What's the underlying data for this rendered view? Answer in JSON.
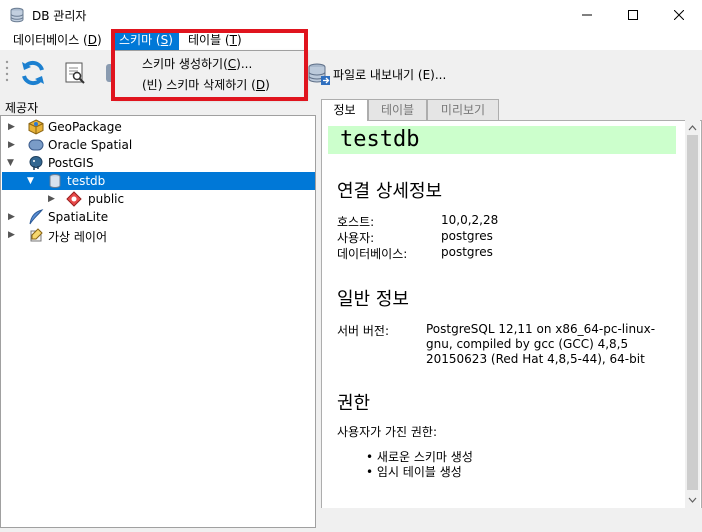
{
  "window": {
    "title": "DB 관리자"
  },
  "menu": {
    "items": [
      {
        "label": "데이터베이스 (",
        "mnemonic": "D",
        "close": ")"
      },
      {
        "label": "스키마 (",
        "mnemonic": "S",
        "close": ")"
      },
      {
        "label": "테이블 (",
        "mnemonic": "T",
        "close": ")"
      }
    ]
  },
  "schema_menu": {
    "items": [
      {
        "label": "스키마 생성하기(",
        "mnemonic": "C",
        "close": ")..."
      },
      {
        "label": "(빈) 스키마 삭제하기 (",
        "mnemonic": "D",
        "close": ")"
      }
    ]
  },
  "toolbar": {
    "export_label": "파일로 내보내기 (E)..."
  },
  "providers": {
    "header": "제공자",
    "items": [
      "GeoPackage",
      "Oracle Spatial",
      "PostGIS",
      "testdb",
      "public",
      "SpatiaLite",
      "가상 레이어"
    ]
  },
  "tabs": [
    "정보",
    "테이블",
    "미리보기"
  ],
  "info": {
    "db_name": "testdb",
    "conn_heading": "연결 상세정보",
    "host_label": "호스트:",
    "host_value": "10,0,2,28",
    "user_label": "사용자:",
    "user_value": "postgres",
    "db_label": "데이터베이스:",
    "db_value": "postgres",
    "general_heading": "일반 정보",
    "server_label": "서버 버전:",
    "server_value": "PostgreSQL 12,11 on x86_64-pc-linux-gnu, compiled by gcc (GCC) 4,8,5 20150623 (Red Hat 4,8,5-44), 64-bit",
    "priv_heading": "권한",
    "priv_label": "사용자가 가진 권한:",
    "privileges": [
      "새로운 스키마 생성",
      "임시 테이블 생성"
    ]
  },
  "colors": {
    "selection": "#0078d7",
    "db_title_bg": "#ccffcc",
    "highlight_border": "#e0141e"
  }
}
